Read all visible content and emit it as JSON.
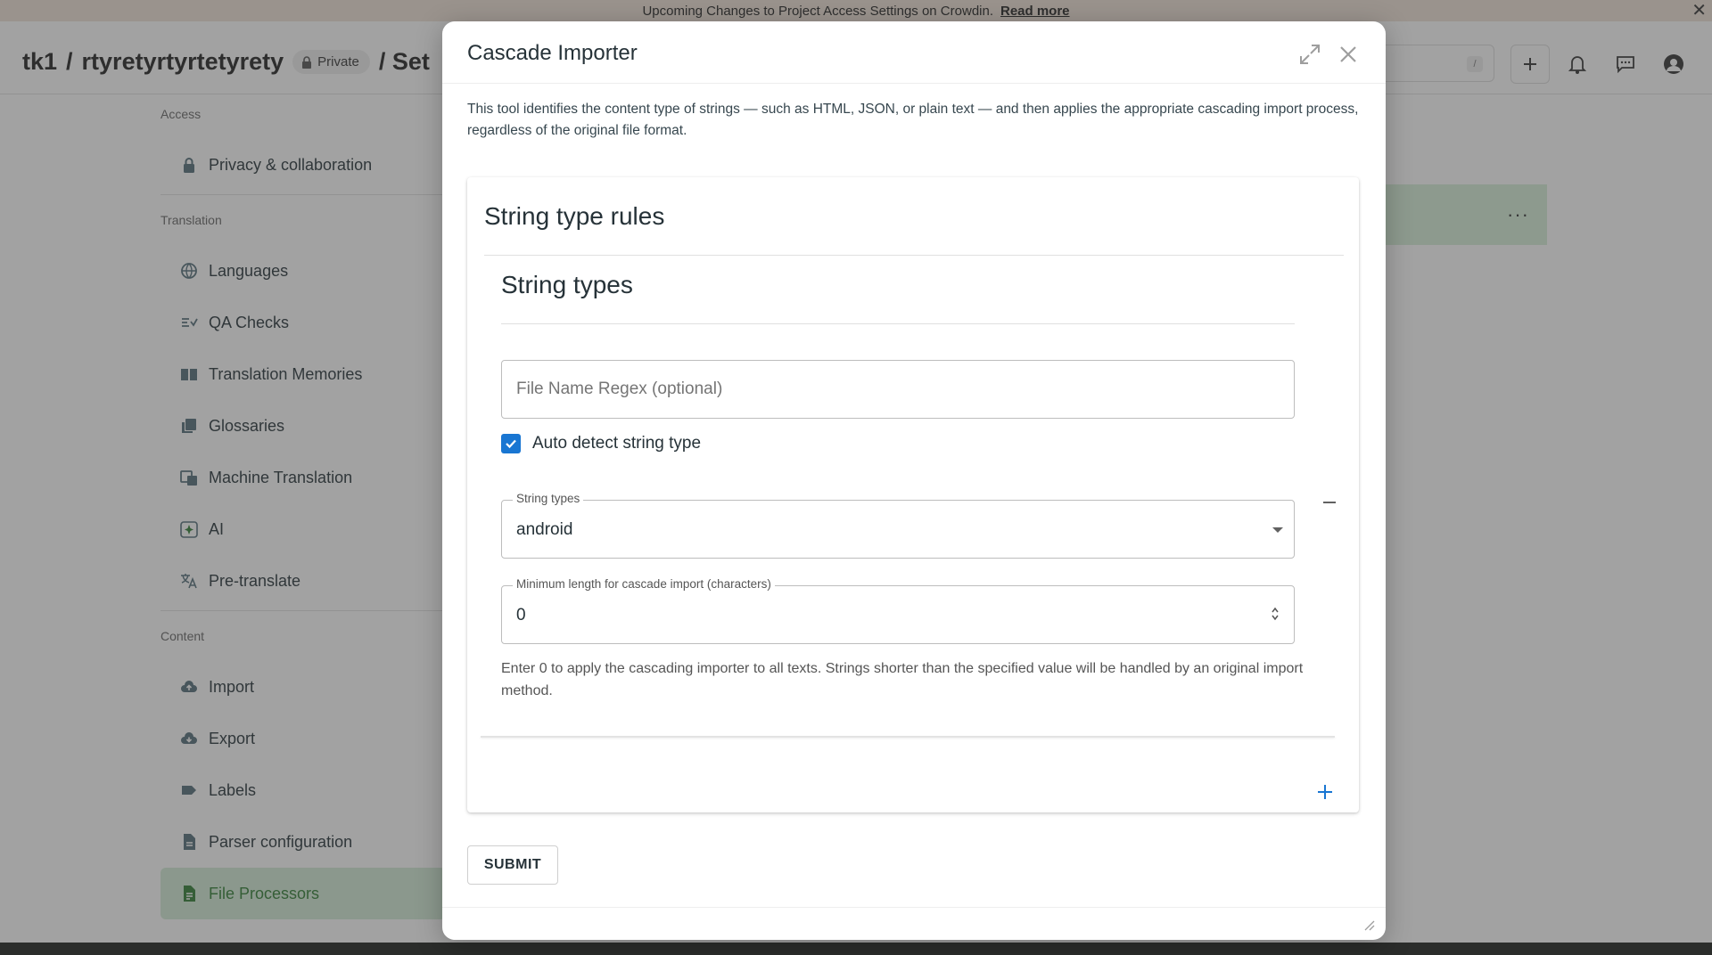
{
  "banner": {
    "text": "Upcoming Changes to Project Access Settings on Crowdin.",
    "link": "Read more",
    "close": "✕"
  },
  "header": {
    "owner": "tk1",
    "separator": "/",
    "project": "rtyretyrtyrtetyrety",
    "visibility": "Private",
    "section_fragment": "/ Set",
    "search_shortcut": "/"
  },
  "sidebar": {
    "sections": [
      {
        "title": "Access",
        "items": [
          {
            "label": "Privacy & collaboration",
            "icon": "lock-icon"
          }
        ]
      },
      {
        "title": "Translation",
        "items": [
          {
            "label": "Languages",
            "icon": "globe-icon"
          },
          {
            "label": "QA Checks",
            "icon": "qa-check-icon"
          },
          {
            "label": "Translation Memories",
            "icon": "book-icon"
          },
          {
            "label": "Glossaries",
            "icon": "glossary-icon"
          },
          {
            "label": "Machine Translation",
            "icon": "machine-translation-icon"
          },
          {
            "label": "AI",
            "icon": "ai-sparkle-icon"
          },
          {
            "label": "Pre-translate",
            "icon": "translate-icon"
          }
        ]
      },
      {
        "title": "Content",
        "items": [
          {
            "label": "Import",
            "icon": "cloud-upload-icon"
          },
          {
            "label": "Export",
            "icon": "cloud-download-icon"
          },
          {
            "label": "Labels",
            "icon": "label-icon"
          },
          {
            "label": "Parser configuration",
            "icon": "document-icon"
          },
          {
            "label": "File Processors",
            "icon": "file-processor-icon",
            "active": true
          }
        ]
      }
    ]
  },
  "background_row": {
    "menu": "···"
  },
  "modal": {
    "title": "Cascade Importer",
    "description": "This tool identifies the content type of strings — such as HTML, JSON, or plain text — and then applies the appropriate cascading import process, regardless of the original file format.",
    "rules_title": "String type rules",
    "types_title": "String types",
    "regex_placeholder": "File Name Regex (optional)",
    "regex_value": "",
    "auto_detect_label": "Auto detect string type",
    "auto_detect_checked": true,
    "string_types_label": "String types",
    "string_types_value": "android",
    "min_length_label": "Minimum length for cascade import (characters)",
    "min_length_value": "0",
    "help_text": "Enter 0 to apply the cascading importer to all texts. Strings shorter than the specified value will be handled by an original import method.",
    "submit_label": "SUBMIT"
  },
  "colors": {
    "accent": "#1976d2",
    "active_nav": "#2e7d32",
    "active_nav_bg": "#d4ecd6",
    "banner_bg": "#efe2d6"
  }
}
